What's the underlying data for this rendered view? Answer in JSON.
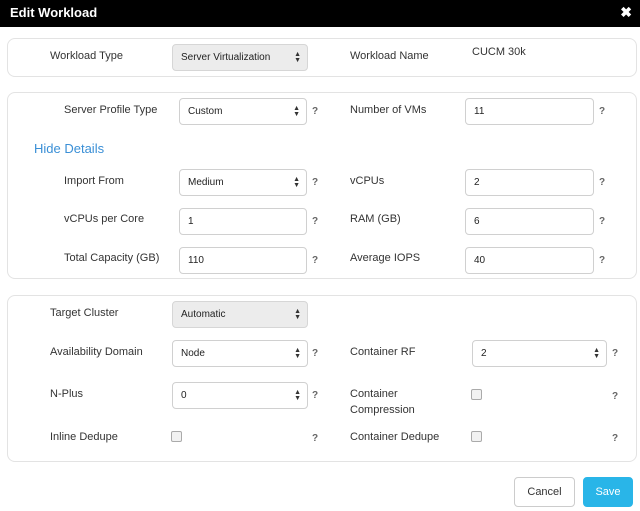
{
  "dialog": {
    "title": "Edit Workload",
    "close_icon": "close-icon"
  },
  "workload": {
    "type_label": "Workload Type",
    "type_value": "Server Virtualization",
    "name_label": "Workload Name",
    "name_value": "CUCM 30k"
  },
  "profile": {
    "server_profile_type_label": "Server Profile Type",
    "server_profile_type_value": "Custom",
    "num_vms_label": "Number of VMs",
    "num_vms_value": "11",
    "hide_details_link": "Hide Details",
    "import_from_label": "Import From",
    "import_from_value": "Medium",
    "vcpus_label": "vCPUs",
    "vcpus_value": "2",
    "vcpus_per_core_label": "vCPUs per Core",
    "vcpus_per_core_value": "1",
    "ram_label": "RAM (GB)",
    "ram_value": "6",
    "total_capacity_label": "Total Capacity (GB)",
    "total_capacity_value": "110",
    "avg_iops_label": "Average IOPS",
    "avg_iops_value": "40"
  },
  "cluster": {
    "target_cluster_label": "Target Cluster",
    "target_cluster_value": "Automatic",
    "availability_domain_label": "Availability Domain",
    "availability_domain_value": "Node",
    "container_rf_label": "Container RF",
    "container_rf_value": "2",
    "n_plus_label": "N-Plus",
    "n_plus_value": "0",
    "container_compression_label_line1": "Container",
    "container_compression_label_line2": "Compression",
    "container_compression_checked": false,
    "inline_dedupe_label": "Inline Dedupe",
    "inline_dedupe_checked": false,
    "container_dedupe_label": "Container Dedupe",
    "container_dedupe_checked": false
  },
  "help_glyph": "?",
  "select_arrows_up": "▲",
  "select_arrows_down": "▼",
  "footer": {
    "cancel_label": "Cancel",
    "save_label": "Save"
  },
  "colors": {
    "header_bg": "#000000",
    "link": "#3a8fd6",
    "primary_button": "#29b5e8"
  }
}
